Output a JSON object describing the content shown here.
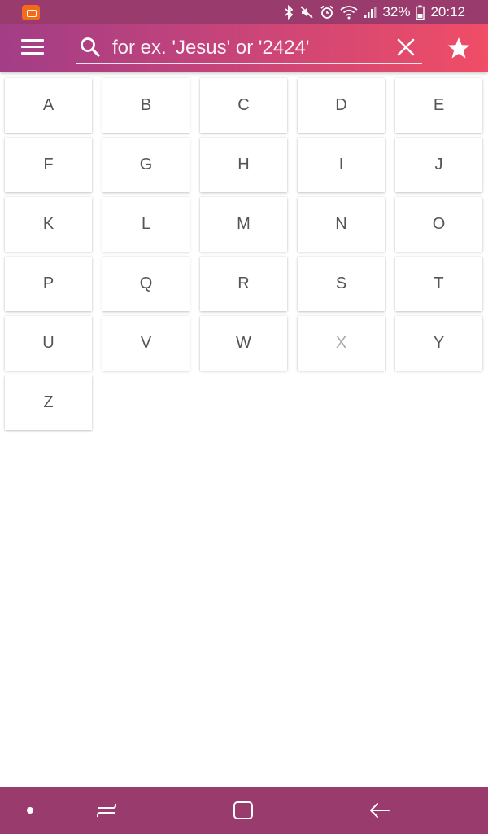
{
  "status_bar": {
    "battery": "32%",
    "time": "20:12",
    "icons": [
      "notification-app-icon",
      "bluetooth-icon",
      "mute-icon",
      "alarm-icon",
      "wifi-icon",
      "signal-icon",
      "battery-icon"
    ]
  },
  "app_bar": {
    "menu_icon": "hamburger-menu-icon",
    "search": {
      "placeholder": "for ex. 'Jesus' or '2424'",
      "value": ""
    },
    "clear_icon": "close-icon",
    "favorites_icon": "star-icon"
  },
  "letters": [
    {
      "label": "A",
      "enabled": true
    },
    {
      "label": "B",
      "enabled": true
    },
    {
      "label": "C",
      "enabled": true
    },
    {
      "label": "D",
      "enabled": true
    },
    {
      "label": "E",
      "enabled": true
    },
    {
      "label": "F",
      "enabled": true
    },
    {
      "label": "G",
      "enabled": true
    },
    {
      "label": "H",
      "enabled": true
    },
    {
      "label": "I",
      "enabled": true
    },
    {
      "label": "J",
      "enabled": true
    },
    {
      "label": "K",
      "enabled": true
    },
    {
      "label": "L",
      "enabled": true
    },
    {
      "label": "M",
      "enabled": true
    },
    {
      "label": "N",
      "enabled": true
    },
    {
      "label": "O",
      "enabled": true
    },
    {
      "label": "P",
      "enabled": true
    },
    {
      "label": "Q",
      "enabled": true
    },
    {
      "label": "R",
      "enabled": true
    },
    {
      "label": "S",
      "enabled": true
    },
    {
      "label": "T",
      "enabled": true
    },
    {
      "label": "U",
      "enabled": true
    },
    {
      "label": "V",
      "enabled": true
    },
    {
      "label": "W",
      "enabled": true
    },
    {
      "label": "X",
      "enabled": false
    },
    {
      "label": "Y",
      "enabled": true
    },
    {
      "label": "Z",
      "enabled": true
    }
  ],
  "nav_bar": {
    "icons": [
      "dot-icon",
      "recent-apps-icon",
      "home-icon",
      "back-icon"
    ]
  },
  "colors": {
    "status_bar": "#9a3b6e",
    "app_bar_start": "#a23d86",
    "app_bar_end": "#f04d66",
    "letter_text": "#555555",
    "letter_disabled": "#aaaaaa",
    "nav_bar": "#9a3b6e"
  }
}
